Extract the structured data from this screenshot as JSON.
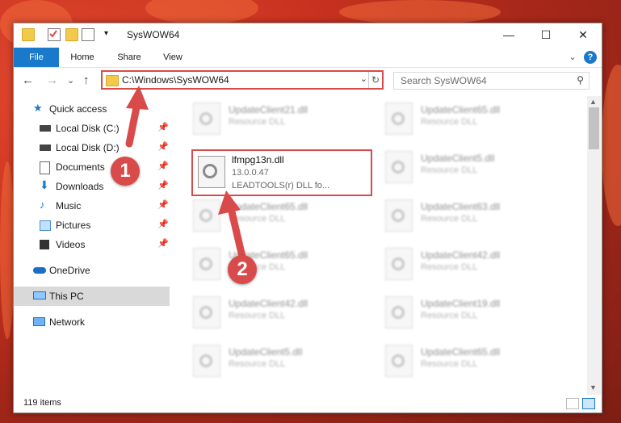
{
  "window": {
    "title": "SysWOW64"
  },
  "window_controls": {
    "minimize": "—",
    "maximize": "☐",
    "close": "✕"
  },
  "ribbon": {
    "tabs": [
      "File",
      "Home",
      "Share",
      "View"
    ],
    "expand": "⌄",
    "help": "?"
  },
  "nav": {
    "back": "←",
    "forward": "→",
    "recent": "⌄",
    "up": "↑"
  },
  "address": {
    "path": "C:\\Windows\\SysWOW64",
    "dropdown": "⌄",
    "refresh": "↻"
  },
  "search": {
    "placeholder": "Search SysWOW64",
    "icon": "⚲"
  },
  "sidebar": {
    "items": [
      {
        "label": "Quick access",
        "icon": "star-icon"
      },
      {
        "label": "Local Disk (C:)",
        "icon": "drive-icon",
        "pinned": true
      },
      {
        "label": "Local Disk (D:)",
        "icon": "drive-icon",
        "pinned": true
      },
      {
        "label": "Documents",
        "icon": "documents-icon",
        "pinned": true
      },
      {
        "label": "Downloads",
        "icon": "download-icon",
        "pinned": true
      },
      {
        "label": "Music",
        "icon": "music-icon",
        "pinned": true
      },
      {
        "label": "Pictures",
        "icon": "pictures-icon",
        "pinned": true
      },
      {
        "label": "Videos",
        "icon": "videos-icon",
        "pinned": true
      },
      {
        "label": "OneDrive",
        "icon": "cloud-icon"
      },
      {
        "label": "This PC",
        "icon": "computer-icon",
        "selected": true
      },
      {
        "label": "Network",
        "icon": "network-icon"
      }
    ],
    "pin_glyph": "📌"
  },
  "files": [
    {
      "name": "UpdateClient21.dll",
      "desc": "Resource DLL"
    },
    {
      "name": "UpdateClient65.dll",
      "desc": "Resource DLL"
    },
    {
      "name": "UpdateClient5.dll",
      "desc": "Resource DLL"
    },
    {
      "name": "UpdateClient65.dll",
      "desc": "Resource DLL"
    },
    {
      "name": "UpdateClient63.dll",
      "desc": "Resource DLL"
    },
    {
      "name": "UpdateClient65.dll",
      "desc": "Resource DLL"
    },
    {
      "name": "UpdateClient42.dll",
      "desc": "Resource DLL"
    },
    {
      "name": "UpdateClient42.dll",
      "desc": "Resource DLL"
    },
    {
      "name": "UpdateClient19.dll",
      "desc": "Resource DLL"
    },
    {
      "name": "UpdateClient5.dll",
      "desc": "Resource DLL"
    },
    {
      "name": "UpdateClient65.dll",
      "desc": "Resource DLL"
    }
  ],
  "highlighted_file": {
    "name": "lfmpg13n.dll",
    "version": "13.0.0.47",
    "desc": "LEADTOOLS(r) DLL fo..."
  },
  "annotations": {
    "step1": "1",
    "step2": "2",
    "color": "#d94a4a"
  },
  "status": {
    "count": "119 items"
  }
}
